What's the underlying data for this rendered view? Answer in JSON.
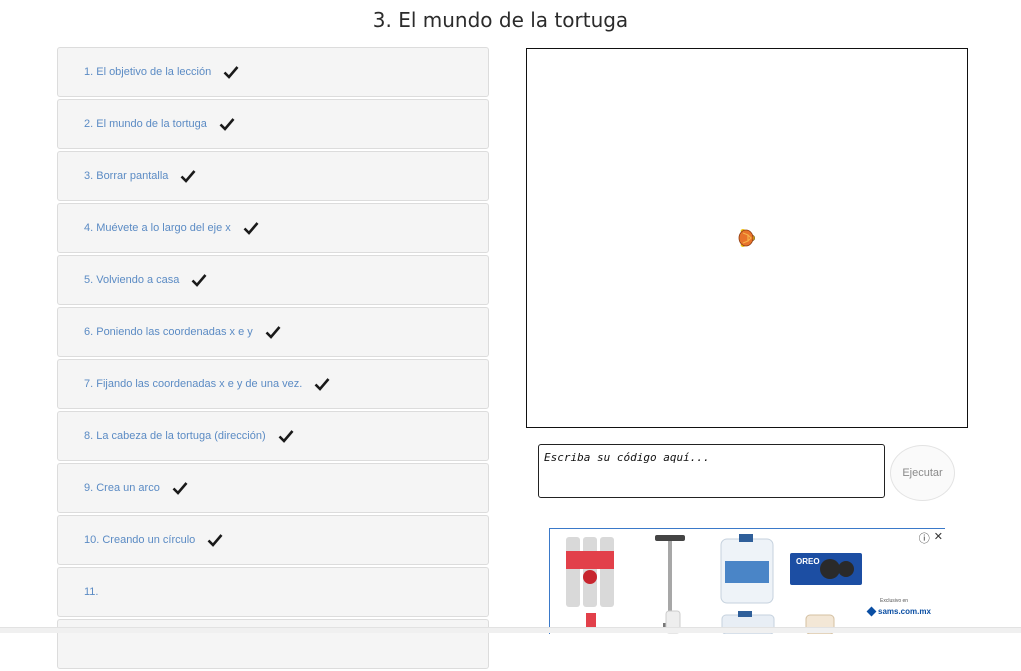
{
  "page": {
    "title": "3. El mundo de la tortuga"
  },
  "lessons": [
    {
      "label": "1. El objetivo de la lección",
      "completed": true
    },
    {
      "label": "2. El mundo de la tortuga",
      "completed": true
    },
    {
      "label": "3. Borrar pantalla",
      "completed": true
    },
    {
      "label": "4. Muévete a lo largo del eje x",
      "completed": true
    },
    {
      "label": "5. Volviendo a casa",
      "completed": true
    },
    {
      "label": "6. Poniendo las coordenadas x e y",
      "completed": true
    },
    {
      "label": "7. Fijando las coordenadas x e y de una vez.",
      "completed": true
    },
    {
      "label": "8. La cabeza de la tortuga (dirección)",
      "completed": true
    },
    {
      "label": "9. Crea un arco",
      "completed": true
    },
    {
      "label": "10. Creando un círculo",
      "completed": true
    },
    {
      "label": "11.",
      "completed": false
    }
  ],
  "editor": {
    "placeholder": "Escriba su código aquí...",
    "run_label": "Ejecutar"
  },
  "ad": {
    "controls": {
      "info": "ⓘ",
      "close": "✕"
    },
    "brand_text": "OREO",
    "retailer_text": "sams.com.mx",
    "retailer_subtext": "Exclusivo en"
  },
  "colors": {
    "lesson_link": "#5b8bc4",
    "turtle_shell": "#e8732a",
    "turtle_body": "#f0c419"
  }
}
